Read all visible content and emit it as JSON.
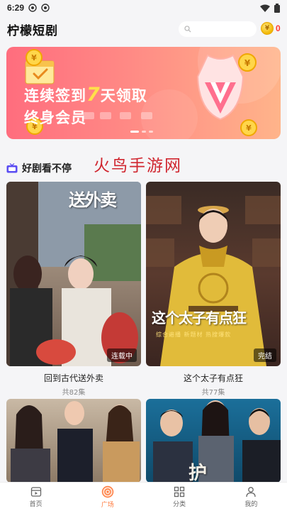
{
  "status_bar": {
    "time": "6:29"
  },
  "header": {
    "title": "柠檬短剧",
    "search_placeholder": "",
    "coin_count": "0"
  },
  "banner": {
    "line1_prefix": "连续签到",
    "line1_number": "7",
    "line1_suffix": "天领取",
    "line2": "终身会员"
  },
  "section": {
    "title": "好剧看不停"
  },
  "watermark": "火鸟手游网",
  "dramas": [
    {
      "name": "回到古代送外卖",
      "episodes": "共82集",
      "status": "连载中",
      "poster_text": "送外卖"
    },
    {
      "name": "这个太子有点狂",
      "episodes": "共77集",
      "status": "完结",
      "poster_text": "这个太子有点狂",
      "poster_subtext": "综合遍播  新题材  热搜爆款"
    },
    {
      "name": "",
      "episodes": "",
      "status": ""
    },
    {
      "name": "",
      "episodes": "",
      "status": "",
      "poster_text": "护"
    }
  ],
  "nav": {
    "items": [
      {
        "label": "首页",
        "icon": "home-icon"
      },
      {
        "label": "广场",
        "icon": "square-icon",
        "active": true
      },
      {
        "label": "分类",
        "icon": "category-icon"
      },
      {
        "label": "我的",
        "icon": "profile-icon"
      }
    ]
  },
  "colors": {
    "accent": "#ff7a3d",
    "coin": "#ff3b30",
    "banner_start": "#ff6d7e",
    "banner_end": "#ffb48a"
  }
}
